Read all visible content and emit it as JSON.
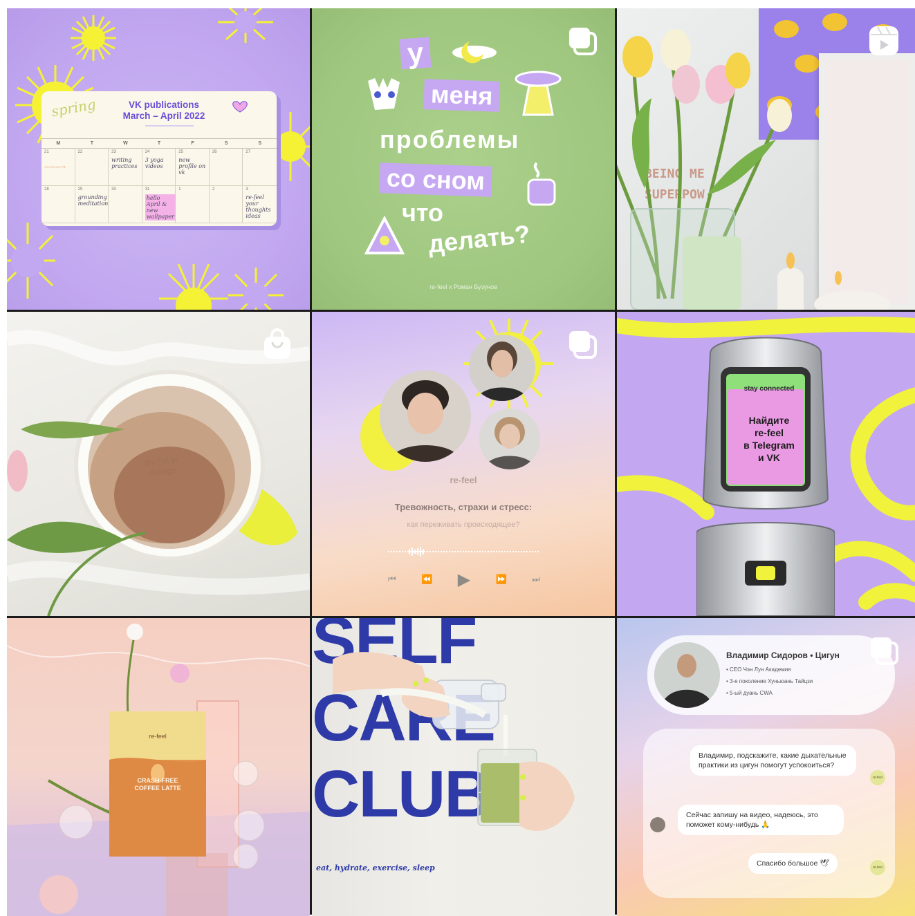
{
  "tiles": [
    {
      "id": "calendar-post",
      "badge": "none",
      "calendar": {
        "script_word": "spring",
        "title_line1": "VK publications",
        "title_line2": "March – April 2022",
        "weekdays": [
          "M",
          "T",
          "W",
          "T",
          "F",
          "S",
          "S"
        ],
        "week1": [
          "21",
          "22",
          "23",
          "24",
          "25",
          "26",
          "27"
        ],
        "week2": [
          "28",
          "29",
          "30",
          "31",
          "1",
          "2",
          "3"
        ],
        "notes": {
          "n1": "writing practices",
          "n2": "3 yoga videos",
          "n3": "new profile on vk",
          "n4": "grounding meditation",
          "n5": "hello April & new wallpaper",
          "n6": "re-feel your thoughts ideas"
        }
      }
    },
    {
      "id": "sleep-post",
      "badge": "carousel",
      "words": [
        "у",
        "меня",
        "проблемы",
        "со сном",
        "что",
        "делать?"
      ],
      "footer": "re-feel x Роман Бузунов"
    },
    {
      "id": "tulips-post",
      "badge": "reel",
      "frame_text_line1": "BEING ME",
      "frame_text_line2": "SUPERPOW"
    },
    {
      "id": "coffee-post",
      "badge": "shop",
      "cup_text_line1": "it's OK to",
      "cup_text_line2": "change"
    },
    {
      "id": "podcast-post",
      "badge": "carousel",
      "brand": "re-feel",
      "title": "Тревожность, страхи и стресс:",
      "subtitle": "как переживать происходящее?",
      "controls": [
        "⏮",
        "⏪",
        "▶",
        "⏩",
        "⏭"
      ]
    },
    {
      "id": "phone-post",
      "badge": "none",
      "screen_tag": "stay connected",
      "screen_line1": "Найдите",
      "screen_line2": "re-feel",
      "screen_line3": "в Telegram",
      "screen_line4": "и VK"
    },
    {
      "id": "product-post",
      "badge": "none",
      "bag_brand": "re-feel",
      "bag_name_line1": "CRASH-FREE",
      "bag_name_line2": "COFFEE LATTE"
    },
    {
      "id": "selfcare-post",
      "badge": "none",
      "shirt_line1": "SELF",
      "shirt_line2": "CARE",
      "shirt_line3": "CLUB",
      "shirt_tagline": "eat, hydrate, exercise, sleep"
    },
    {
      "id": "chat-post",
      "badge": "carousel",
      "profile_name": "Владимир Сидоров • Цигун",
      "profile_lines": [
        "• CEO Чэн Лун Академия",
        "• 3-е поколение Хуньюань Тайцзи",
        "• 5-ый дуань CWA"
      ],
      "msg1": "Владимир, подскажите, какие дыхательные практики из цигун помогут успокоиться?",
      "msg2": "Сейчас запишу на видео, надеюсь, это поможет кому-нибудь 🙏",
      "msg3": "Спасибо большое 🕊",
      "brand_mini": "re-feel"
    }
  ],
  "colors": {
    "lavender": "#c2a8f0",
    "lime": "#f2f24a",
    "green": "#a2c982",
    "royal_blue": "#2e3aa8"
  }
}
